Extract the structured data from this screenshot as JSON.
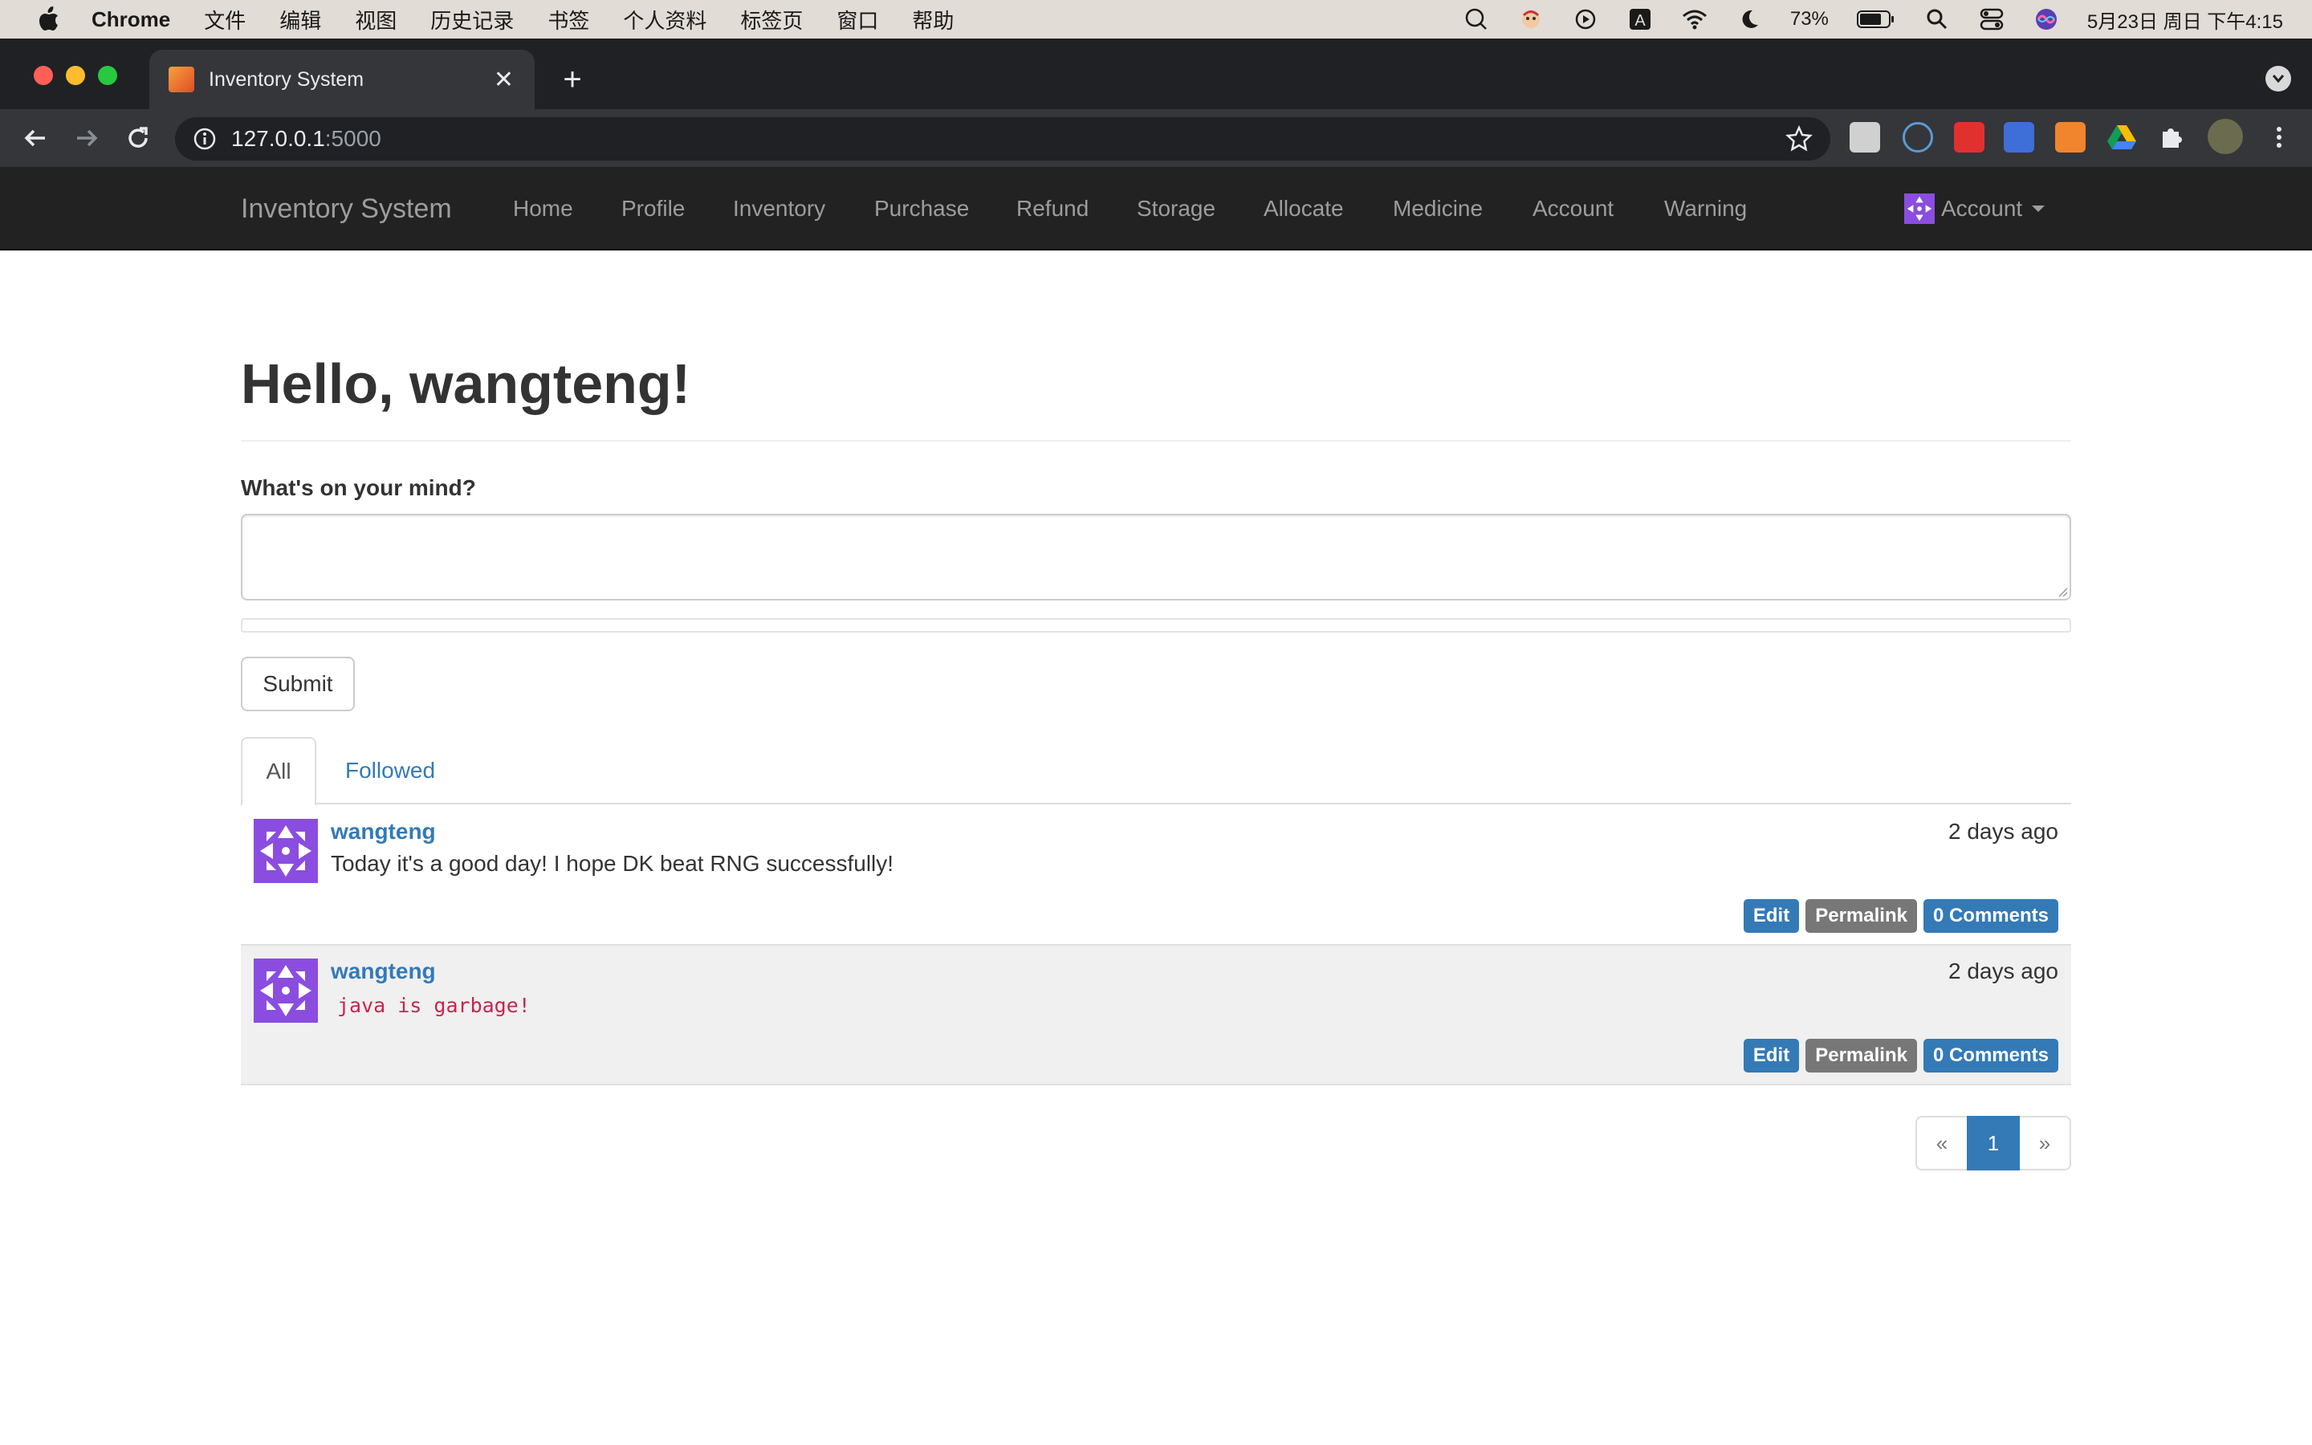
{
  "menubar": {
    "app": "Chrome",
    "items": [
      "文件",
      "编辑",
      "视图",
      "历史记录",
      "书签",
      "个人资料",
      "标签页",
      "窗口",
      "帮助"
    ],
    "battery": "73%",
    "datetime": "5月23日 周日 下午4:15"
  },
  "browser": {
    "tab_title": "Inventory System",
    "url_host": "127.0.0.1",
    "url_port": ":5000"
  },
  "navbar": {
    "brand": "Inventory System",
    "links": [
      "Home",
      "Profile",
      "Inventory",
      "Purchase",
      "Refund",
      "Storage",
      "Allocate",
      "Medicine",
      "Account",
      "Warning"
    ],
    "account": "Account"
  },
  "page": {
    "greeting": "Hello, wangteng!",
    "form_label": "What's on your mind?",
    "submit": "Submit",
    "tabs": [
      "All",
      "Followed"
    ]
  },
  "posts": [
    {
      "author": "wangteng",
      "time": "2 days ago",
      "body": "Today it's a good day! I hope DK beat RNG successfully!",
      "edit": "Edit",
      "permalink": "Permalink",
      "comments": "0 Comments"
    },
    {
      "author": "wangteng",
      "time": "2 days ago",
      "body": "java is garbage!",
      "edit": "Edit",
      "permalink": "Permalink",
      "comments": "0 Comments"
    }
  ],
  "pagination": {
    "prev": "«",
    "current": "1",
    "next": "»"
  },
  "colors": {
    "navbar_bg": "#222222",
    "link": "#337ab7",
    "avatar": "#8a4de0"
  }
}
